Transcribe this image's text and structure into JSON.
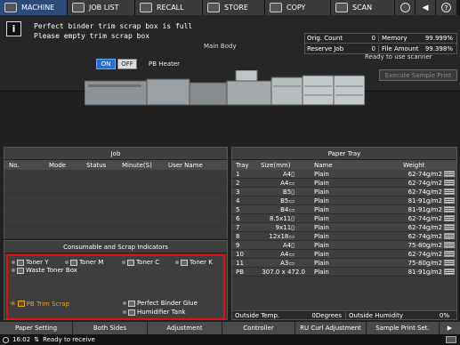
{
  "top_tabs": {
    "machine": "MACHINE",
    "job_list": "JOB LIST",
    "recall": "RECALL",
    "store": "STORE",
    "copy": "COPY",
    "scan": "SCAN"
  },
  "status": {
    "message_line1": "Perfect binder trim scrap box is full",
    "message_line2": "Please empty trim scrap box",
    "main_body": "Main Body",
    "orig_count_label": "Orig. Count",
    "orig_count_value": "0",
    "memory_label": "Memory",
    "memory_value": "99.999%",
    "reserve_job_label": "Reserve Job",
    "reserve_job_value": "0",
    "file_amount_label": "File Amount",
    "file_amount_value": "99.398%",
    "scanner_status": "Ready to use scanner",
    "execute_sample_print": "Execute Sample Print",
    "pb_heater_on": "ON",
    "pb_heater_off": "OFF",
    "pb_heater_label": "PB Heater"
  },
  "job": {
    "title": "Job",
    "col_no": "No.",
    "col_mode": "Mode",
    "col_status": "Status",
    "col_minutes": "Minute(S)",
    "col_user": "User Name"
  },
  "consumables": {
    "title": "Consumable and Scrap Indicators",
    "toner_y": "Toner Y",
    "toner_m": "Toner M",
    "toner_c": "Toner C",
    "toner_k": "Toner K",
    "waste_toner": "Waste Toner Box",
    "pb_trim_scrap": "PB Trim Scrap",
    "perfect_binder_glue": "Perfect Binder Glue",
    "humidifier_tank": "Humidifier Tank"
  },
  "paper_tray": {
    "title": "Paper Tray",
    "col_tray": "Tray",
    "col_size": "Size(mm)",
    "col_name": "Name",
    "col_weight": "Weight",
    "rows": [
      {
        "tray": "1",
        "size": "A4▯",
        "name": "Plain",
        "weight": "62-74g/m2"
      },
      {
        "tray": "2",
        "size": "A4▭",
        "name": "Plain",
        "weight": "62-74g/m2"
      },
      {
        "tray": "3",
        "size": "B5▯",
        "name": "Plain",
        "weight": "62-74g/m2"
      },
      {
        "tray": "4",
        "size": "B5▭",
        "name": "Plain",
        "weight": "81-91g/m2"
      },
      {
        "tray": "5",
        "size": "B4▭",
        "name": "Plain",
        "weight": "81-91g/m2"
      },
      {
        "tray": "6",
        "size": "8.5x11▯",
        "name": "Plain",
        "weight": "62-74g/m2"
      },
      {
        "tray": "7",
        "size": "9x11▯",
        "name": "Plain",
        "weight": "62-74g/m2"
      },
      {
        "tray": "8",
        "size": "12x18▭",
        "name": "Plain",
        "weight": "62-74g/m2"
      },
      {
        "tray": "9",
        "size": "A4▯",
        "name": "Plain",
        "weight": "75-80g/m2"
      },
      {
        "tray": "10",
        "size": "A4▭",
        "name": "Plain",
        "weight": "62-74g/m2"
      },
      {
        "tray": "11",
        "size": "A3▭",
        "name": "Plain",
        "weight": "75-80g/m2"
      },
      {
        "tray": "PB",
        "size": "307.0 x 472.0",
        "name": "Plain",
        "weight": "81-91g/m2"
      }
    ],
    "outside_temp_label": "Outside Temp.",
    "outside_temp_value": "0Degrees",
    "outside_humidity_label": "Outside Humidity",
    "outside_humidity_value": "0%"
  },
  "bottom_tabs": {
    "paper_setting": "Paper Setting",
    "both_sides": "Both Sides",
    "adjustment": "Adjustment",
    "controller": "Controller",
    "ru_curl": "RU Curl Adjustment",
    "sample_print": "Sample Print Set."
  },
  "footer": {
    "time": "16:02",
    "status": "Ready to receive"
  },
  "colors": {
    "alert_border": "#e01010",
    "warning": "#f0a020",
    "active_tab": "#2d4b78",
    "heater_on": "#2a6fd4"
  }
}
